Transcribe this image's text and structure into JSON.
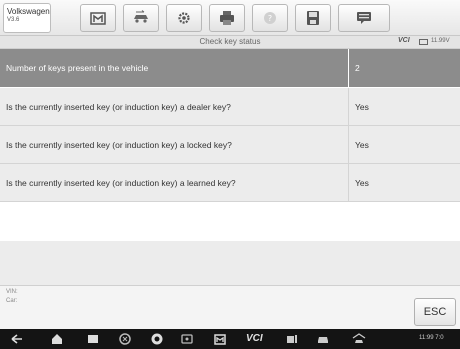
{
  "toolbar": {
    "vehicle_name": "Volkswagen",
    "vehicle_version": "V3.6"
  },
  "titlebar": {
    "title": "Check key status",
    "vci": "VCI",
    "voltage": "11.99V"
  },
  "table": {
    "header": {
      "question": "Number of keys present in the vehicle",
      "answer": "2"
    },
    "rows": [
      {
        "question": "Is the currently inserted key (or induction key) a dealer key?",
        "answer": "Yes"
      },
      {
        "question": "Is the currently inserted key (or induction key) a locked key?",
        "answer": "Yes"
      },
      {
        "question": "Is the currently inserted key (or induction key) a learned key?",
        "answer": "Yes"
      }
    ]
  },
  "info": {
    "vin_label": "VIN:",
    "car_label": "Car:"
  },
  "esc_label": "ESC",
  "navbar": {
    "vcs_label": "VCI",
    "status": "11:99 7:0"
  },
  "colors": {
    "header_bg": "#8c8c8c",
    "row_bg": "#ececec",
    "navbar_bg": "#141414"
  }
}
